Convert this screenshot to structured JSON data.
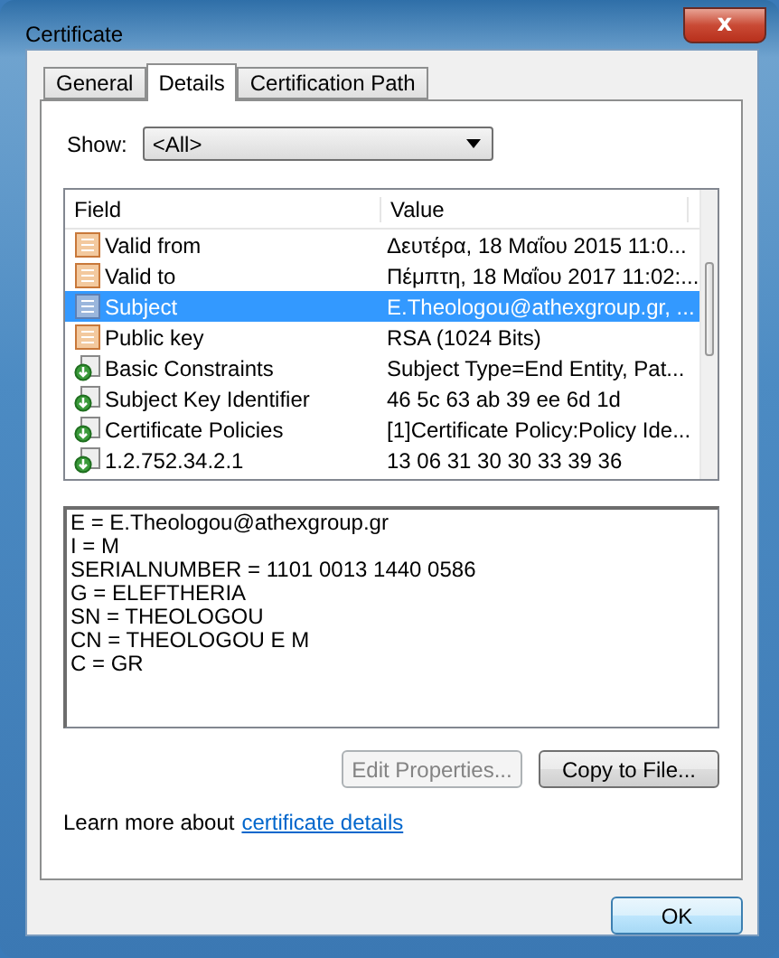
{
  "window": {
    "title": "Certificate",
    "close": "x"
  },
  "tabs": [
    {
      "label": "General",
      "selected": false
    },
    {
      "label": "Details",
      "selected": true
    },
    {
      "label": "Certification Path",
      "selected": false
    }
  ],
  "show": {
    "label": "Show:",
    "value": "<All>"
  },
  "table": {
    "columns": [
      "Field",
      "Value"
    ],
    "rows": [
      {
        "kind": "standard",
        "field": "Valid from",
        "value": "Δευτέρα, 18 Μαΐου 2015 11:0...",
        "selected": false
      },
      {
        "kind": "standard",
        "field": "Valid to",
        "value": "Πέμπτη, 18 Μαΐου 2017 11:02:...",
        "selected": false
      },
      {
        "kind": "standard",
        "field": "Subject",
        "value": "E.Theologou@athexgroup.gr, ...",
        "selected": true
      },
      {
        "kind": "standard",
        "field": "Public key",
        "value": "RSA (1024 Bits)",
        "selected": false
      },
      {
        "kind": "extension",
        "field": "Basic Constraints",
        "value": "Subject Type=End Entity, Pat...",
        "selected": false
      },
      {
        "kind": "extension",
        "field": "Subject Key Identifier",
        "value": "46 5c 63 ab 39 ee 6d 1d",
        "selected": false
      },
      {
        "kind": "extension",
        "field": "Certificate Policies",
        "value": "[1]Certificate Policy:Policy Ide...",
        "selected": false
      },
      {
        "kind": "extension",
        "field": "1.2.752.34.2.1",
        "value": "13 06 31 30 30 33 39 36",
        "selected": false
      }
    ]
  },
  "details": [
    "E = E.Theologou@athexgroup.gr",
    "I = M",
    "SERIALNUMBER = 1101 0013 1440 0586",
    "G = ELEFTHERIA",
    "SN = THEOLOGOU",
    "CN = THEOLOGOU E M",
    "C = GR"
  ],
  "buttons": [
    {
      "label": "Edit Properties...",
      "disabled": true
    },
    {
      "label": "Copy to File...",
      "disabled": false
    }
  ],
  "learn_more": {
    "text": "Learn more about",
    "link": "certificate details"
  },
  "ok": "OK"
}
